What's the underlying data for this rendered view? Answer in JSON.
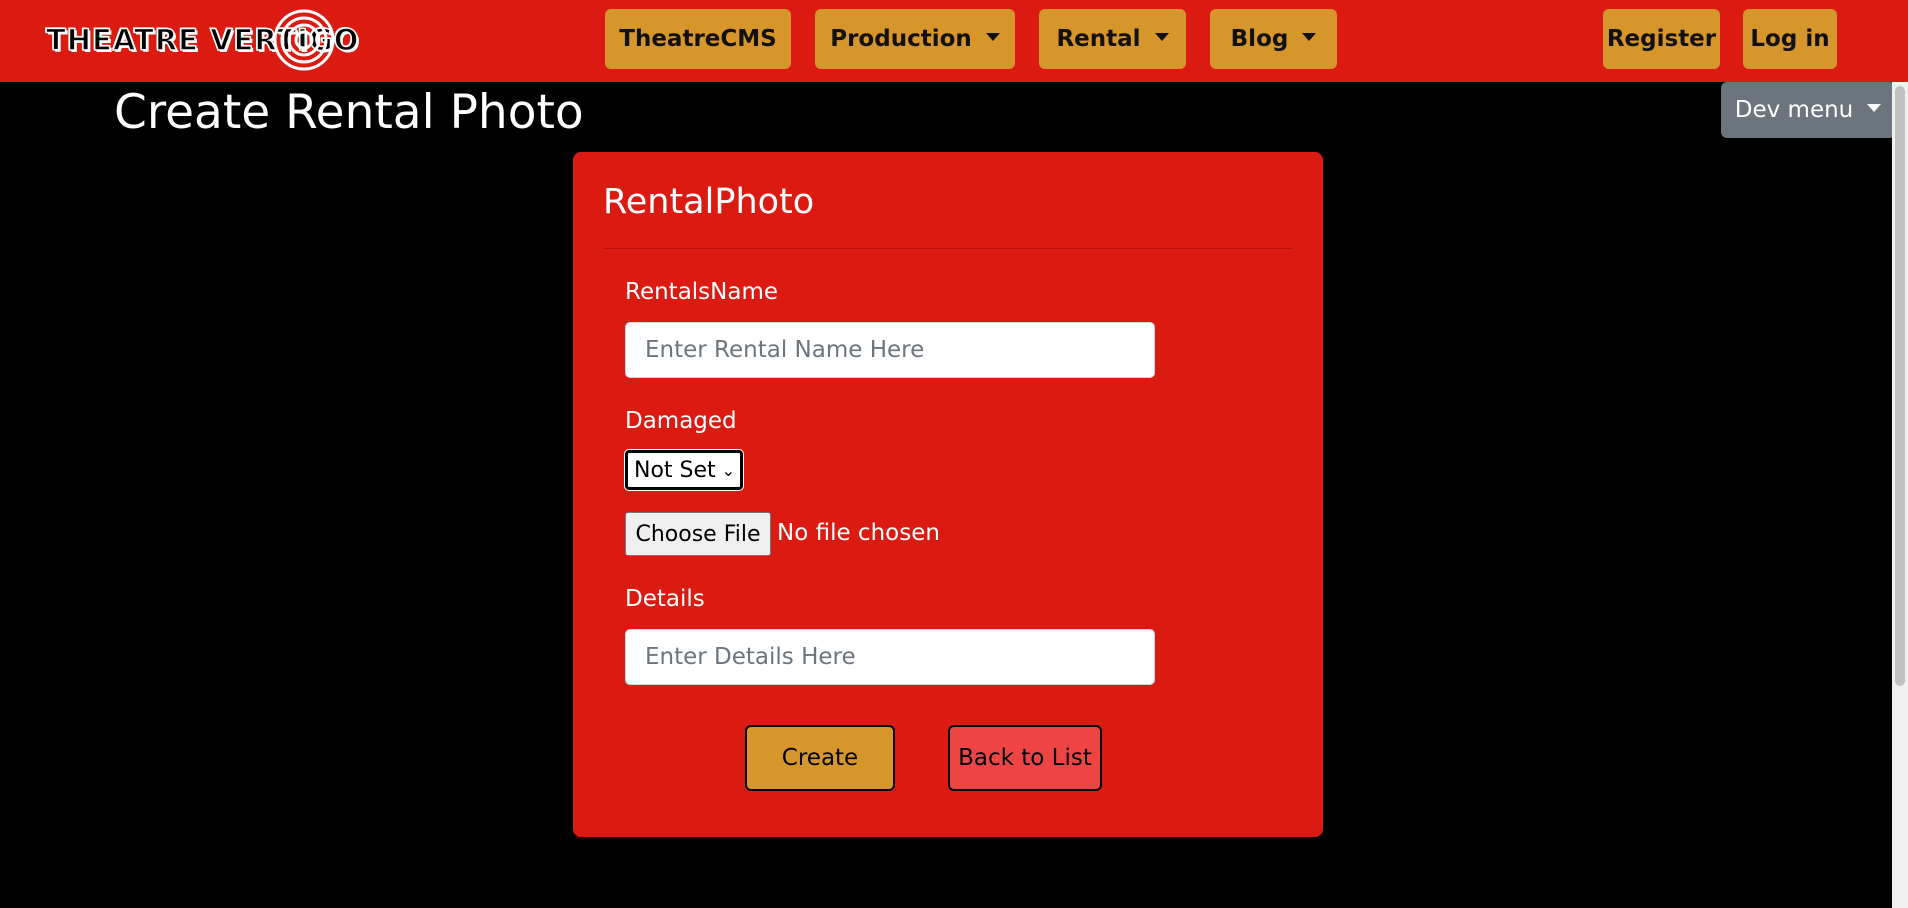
{
  "brand": {
    "logo_text": "THEATRE VERTIGO",
    "colors": {
      "primary": "#db1b12",
      "accent": "#d6962b",
      "background": "#000000",
      "muted": "#6c757d"
    }
  },
  "nav": {
    "theatrecms": "TheatreCMS",
    "production": "Production",
    "rental": "Rental",
    "blog": "Blog",
    "register": "Register",
    "login": "Log in"
  },
  "page": {
    "title": "Create Rental Photo",
    "dev_menu": "Dev menu"
  },
  "form": {
    "heading": "RentalPhoto",
    "rentals_name_label": "RentalsName",
    "rentals_name_placeholder": "Enter Rental Name Here",
    "damaged_label": "Damaged",
    "damaged_selected": "Not Set",
    "choose_file": "Choose File",
    "file_status": "No file chosen",
    "details_label": "Details",
    "details_placeholder": "Enter Details Here",
    "create_button": "Create",
    "back_button": "Back to List"
  }
}
